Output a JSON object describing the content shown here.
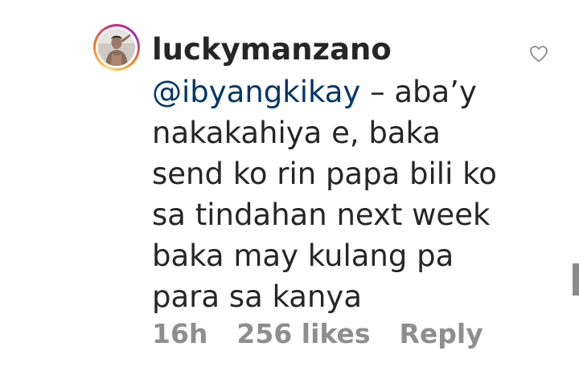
{
  "comment": {
    "username": "luckymanzano",
    "mention": "@ibyangkikay",
    "lines": {
      "l1": " – aba’y",
      "l2": "nakakahiya e, baka",
      "l3": "send ko rin papa bili ko",
      "l4": "sa tindahan next week",
      "l5": "baka may kulang pa",
      "l6": "para sa kanya"
    },
    "time": "16h",
    "likes": "256 likes",
    "reply": "Reply"
  },
  "icons": {
    "like": "heart-outline-icon",
    "avatar": "profile-avatar"
  },
  "colors": {
    "text": "#262626",
    "mention": "#00376b",
    "meta": "#8e8e8e",
    "heart": "#8e8e8e"
  }
}
